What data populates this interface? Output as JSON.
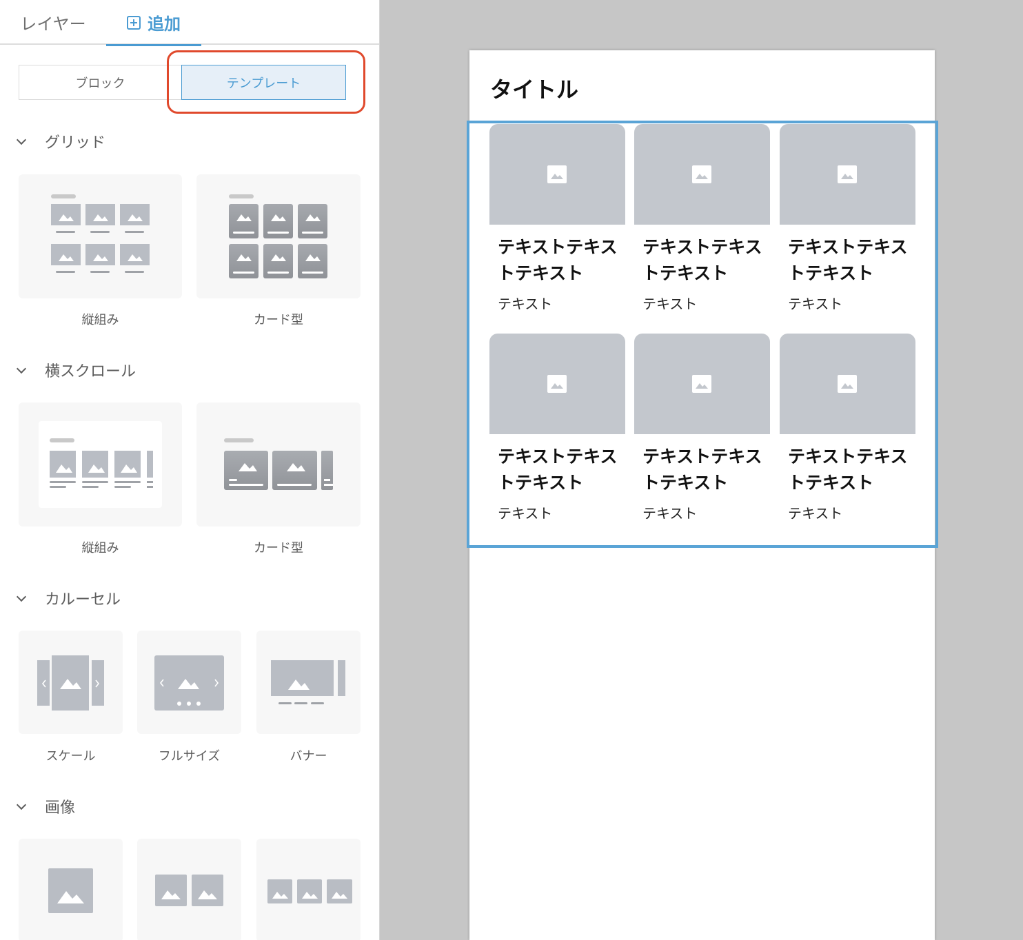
{
  "tabs": {
    "layer": "レイヤー",
    "add": "追加"
  },
  "segments": {
    "block": "ブロック",
    "template": "テンプレート"
  },
  "sections": {
    "grid": {
      "title": "グリッド",
      "items": [
        "縦組み",
        "カード型"
      ]
    },
    "hscroll": {
      "title": "横スクロール",
      "items": [
        "縦組み",
        "カード型"
      ]
    },
    "carousel": {
      "title": "カルーセル",
      "items": [
        "スケール",
        "フルサイズ",
        "バナー"
      ]
    },
    "image": {
      "title": "画像"
    }
  },
  "canvas": {
    "title": "タイトル",
    "cards": [
      {
        "title": "テキストテキストテキスト",
        "sub": "テキスト"
      },
      {
        "title": "テキストテキストテキスト",
        "sub": "テキスト"
      },
      {
        "title": "テキストテキストテキスト",
        "sub": "テキスト"
      },
      {
        "title": "テキストテキストテキスト",
        "sub": "テキスト"
      },
      {
        "title": "テキストテキストテキスト",
        "sub": "テキスト"
      },
      {
        "title": "テキストテキストテキスト",
        "sub": "テキスト"
      }
    ]
  },
  "colors": {
    "accent": "#4a9bd2",
    "highlight": "#e0492c",
    "placeholder": "#c3c7cd"
  }
}
